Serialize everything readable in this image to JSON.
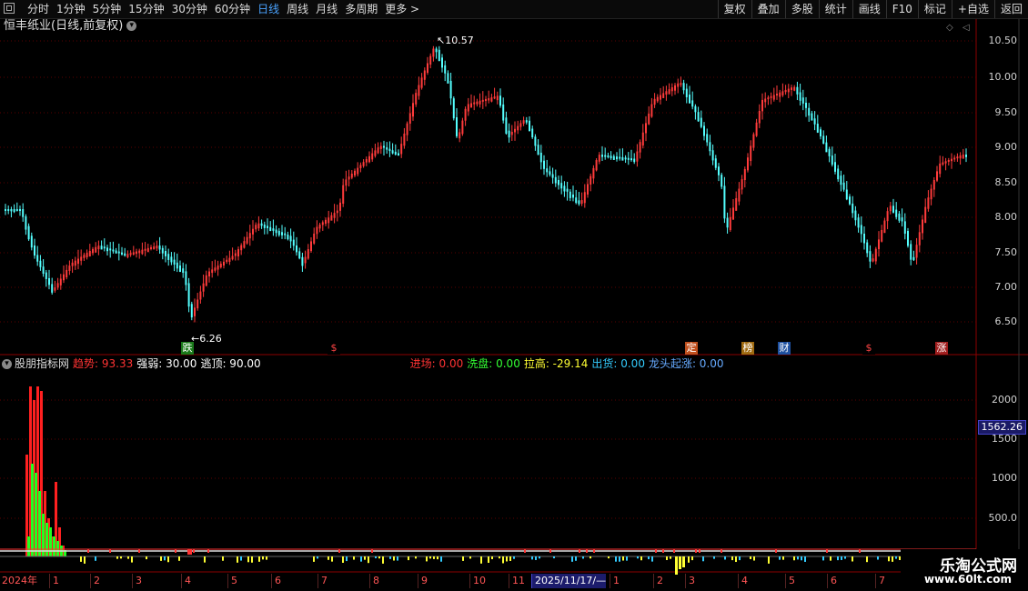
{
  "toolbar": {
    "periods": [
      "分时",
      "1分钟",
      "5分钟",
      "15分钟",
      "30分钟",
      "60分钟",
      "日线",
      "周线",
      "月线",
      "多周期",
      "更多 >"
    ],
    "active_period": "日线",
    "tools": [
      "复权",
      "叠加",
      "多股",
      "统计",
      "画线",
      "F10",
      "标记",
      "+自选",
      "返回"
    ]
  },
  "stock_title": "恒丰纸业(日线,前复权)",
  "price_axis": [
    "10.50",
    "10.00",
    "9.50",
    "9.00",
    "8.50",
    "8.00",
    "7.50",
    "7.00",
    "6.50"
  ],
  "price_marks": {
    "high": "10.57",
    "low": "6.26"
  },
  "events": [
    {
      "label": "跌",
      "color": "#1a7a1a"
    },
    {
      "label": "$",
      "color": "#000000"
    },
    {
      "label": "定",
      "color": "#c0501e"
    },
    {
      "label": "榜",
      "color": "#a06a10"
    },
    {
      "label": "财",
      "color": "#1e50a0"
    },
    {
      "label": "$",
      "color": "#000000"
    },
    {
      "label": "涨",
      "color": "#a01e1e"
    }
  ],
  "indicator": {
    "name": "股朋指标网",
    "items": [
      {
        "label": "趋势: 93.33",
        "color": "#ff3333"
      },
      {
        "label": "强弱: 30.00",
        "color": "#ffffff"
      },
      {
        "label": "逃顶: 90.00",
        "color": "#ffffff"
      },
      {
        "label": "进场: 0.00",
        "color": "#ff3333"
      },
      {
        "label": "洗盘: 0.00",
        "color": "#33ff33"
      },
      {
        "label": "拉高: -29.14",
        "color": "#ffff33"
      },
      {
        "label": "出货: 0.00",
        "color": "#33ccff"
      },
      {
        "label": "龙头起涨: 0.00",
        "color": "#66aaff"
      }
    ],
    "axis": [
      "2000",
      "1500",
      "1000",
      "500.0"
    ],
    "current_value": "1562.26"
  },
  "date_axis": [
    "2024年",
    "1",
    "2",
    "3",
    "4",
    "5",
    "6",
    "7",
    "8",
    "9",
    "10",
    "11",
    "2025/11/17/—",
    "1",
    "2",
    "3",
    "4",
    "5",
    "6",
    "7"
  ],
  "watermark": {
    "line1": "乐淘公式网",
    "line2": "www.60lt.com"
  }
}
